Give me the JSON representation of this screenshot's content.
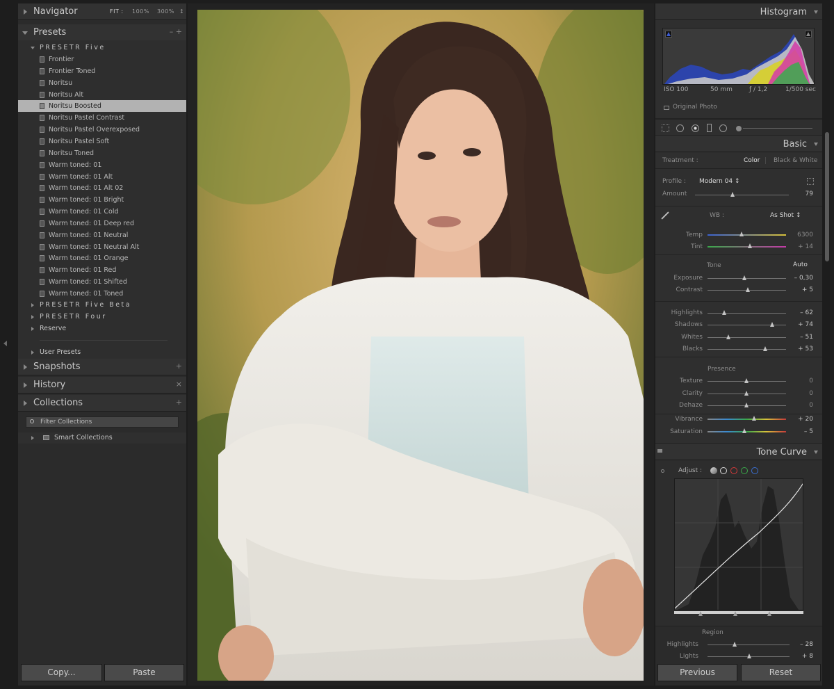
{
  "navigator": {
    "title": "Navigator",
    "zoom": [
      "FIT",
      "100%",
      "300%"
    ],
    "zoom_suffix": ":",
    "menu": "↕"
  },
  "presets": {
    "title": "Presets",
    "actions": "–  +",
    "folders": {
      "five": "PRESETR Five",
      "five_beta": "PRESETR Five Beta",
      "four": "PRESETR Four",
      "reserve": "Reserve",
      "user": "User Presets"
    },
    "items": [
      {
        "label": "Frontier",
        "selected": false
      },
      {
        "label": "Frontier Toned",
        "selected": false
      },
      {
        "label": "Noritsu",
        "selected": false
      },
      {
        "label": "Noritsu Alt",
        "selected": false
      },
      {
        "label": "Noritsu Boosted",
        "selected": true
      },
      {
        "label": "Noritsu Pastel Contrast",
        "selected": false
      },
      {
        "label": "Noritsu Pastel Overexposed",
        "selected": false
      },
      {
        "label": "Noritsu Pastel Soft",
        "selected": false
      },
      {
        "label": "Noritsu Toned",
        "selected": false
      },
      {
        "label": "Warm toned: 01",
        "selected": false
      },
      {
        "label": "Warm toned: 01 Alt",
        "selected": false
      },
      {
        "label": "Warm toned: 01 Alt 02",
        "selected": false
      },
      {
        "label": "Warm toned: 01 Bright",
        "selected": false
      },
      {
        "label": "Warm toned: 01 Cold",
        "selected": false
      },
      {
        "label": "Warm toned: 01 Deep red",
        "selected": false
      },
      {
        "label": "Warm toned: 01 Neutral",
        "selected": false
      },
      {
        "label": "Warm toned: 01 Neutral Alt",
        "selected": false
      },
      {
        "label": "Warm toned: 01 Orange",
        "selected": false
      },
      {
        "label": "Warm toned: 01 Red",
        "selected": false
      },
      {
        "label": "Warm toned: 01 Shifted",
        "selected": false
      },
      {
        "label": "Warm toned: 01 Toned",
        "selected": false
      }
    ]
  },
  "snapshots": {
    "title": "Snapshots",
    "action": "+"
  },
  "history": {
    "title": "History",
    "action": "×"
  },
  "collections": {
    "title": "Collections",
    "action": "+",
    "filter_placeholder": "Filter Collections",
    "smart": "Smart Collections"
  },
  "bottom_left": {
    "copy": "Copy...",
    "paste": "Paste"
  },
  "bottom_right": {
    "previous": "Previous",
    "reset": "Reset"
  },
  "histogram": {
    "title": "Histogram",
    "iso": "ISO 100",
    "focal": "50 mm",
    "aperture": "ƒ / 1,2",
    "shutter": "1/500 sec",
    "original_photo": "Original Photo"
  },
  "basic": {
    "title": "Basic",
    "treatment_label": "Treatment :",
    "treatment_color": "Color",
    "treatment_bw": "Black & White",
    "profile_label": "Profile :",
    "profile_value": "Modern 04",
    "profile_suffix": "↕",
    "amount_label": "Amount",
    "amount_value": "79",
    "wb_label": "WB :",
    "wb_value": "As Shot",
    "wb_suffix": "↕",
    "temp_label": "Temp",
    "temp_value": "6300",
    "tint_label": "Tint",
    "tint_value": "+ 14",
    "tone_label": "Tone",
    "auto_label": "Auto",
    "exposure_label": "Exposure",
    "exposure_value": "– 0,30",
    "contrast_label": "Contrast",
    "contrast_value": "+ 5",
    "highlights_label": "Highlights",
    "highlights_value": "– 62",
    "shadows_label": "Shadows",
    "shadows_value": "+ 74",
    "whites_label": "Whites",
    "whites_value": "– 51",
    "blacks_label": "Blacks",
    "blacks_value": "+ 53",
    "presence_label": "Presence",
    "texture_label": "Texture",
    "texture_value": "0",
    "clarity_label": "Clarity",
    "clarity_value": "0",
    "dehaze_label": "Dehaze",
    "dehaze_value": "0",
    "vibrance_label": "Vibrance",
    "vibrance_value": "+ 20",
    "saturation_label": "Saturation",
    "saturation_value": "– 5"
  },
  "tone_curve": {
    "title": "Tone Curve",
    "adjust_label": "Adjust :",
    "region_label": "Region",
    "highlights_label": "Highlights",
    "highlights_value": "– 28",
    "lights_label": "Lights",
    "lights_value": "+ 8"
  },
  "colors": {
    "panel_bg": "#2b2b2b",
    "selected_row": "#b2b2b2",
    "accent_red": "#d13a3a",
    "accent_green": "#3aa84a",
    "accent_blue": "#3a6fd1"
  }
}
